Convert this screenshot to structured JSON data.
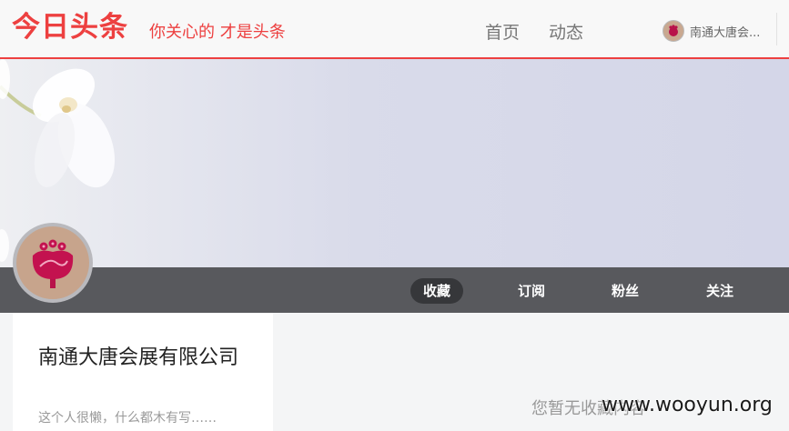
{
  "header": {
    "logo": "今日头条",
    "slogan": "你关心的 才是头条",
    "nav": [
      {
        "label": "首页"
      },
      {
        "label": "动态"
      }
    ],
    "user": {
      "name": "南通大唐会..."
    }
  },
  "tabs": [
    {
      "label": "收藏",
      "active": true
    },
    {
      "label": "订阅",
      "active": false
    },
    {
      "label": "粉丝",
      "active": false
    },
    {
      "label": "关注",
      "active": false
    }
  ],
  "profile": {
    "name": "南通大唐会展有限公司",
    "bio": "这个人很懒，什么都木有写……"
  },
  "empty_message": "您暂无收藏内容",
  "watermark": "www.wooyun.org",
  "colors": {
    "brand": "#ed4040",
    "tabbar": "#58595d",
    "tab_active": "#36373a"
  }
}
